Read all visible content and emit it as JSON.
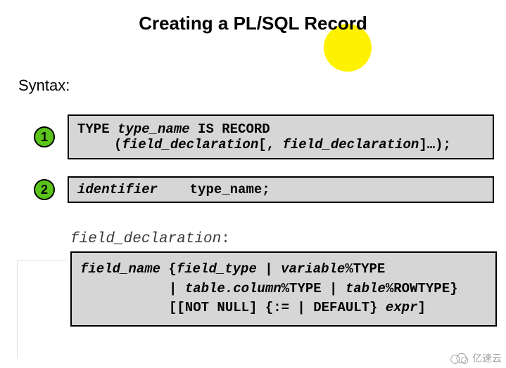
{
  "title": "Creating a PL/SQL Record",
  "syntax_label": "Syntax:",
  "badges": {
    "one": "1",
    "two": "2"
  },
  "code1": {
    "line1_a": "TYPE ",
    "line1_b": "type_name",
    "line1_c": " IS RECORD",
    "line2_a": "(",
    "line2_b": "field_declaration",
    "line2_c": "[, ",
    "line2_d": "field_declaration",
    "line2_e": "]…);"
  },
  "code2": {
    "a": "identifier",
    "spacer": "    ",
    "b": "type_name",
    "c": ";"
  },
  "label_field_decl": "field_declaration",
  "label_colon": ":",
  "code3": {
    "l1_a": "field_name",
    "l1_b": " {",
    "l1_c": "field_type",
    "l1_d": " | ",
    "l1_e": "variable",
    "l1_f": "%TYPE",
    "l2_a": "| ",
    "l2_b": "table.column",
    "l2_c": "%TYPE | ",
    "l2_d": "table",
    "l2_e": "%ROWTYPE}",
    "l3_a": "[[NOT NULL] {:= | DEFAULT} ",
    "l3_b": "expr",
    "l3_c": "]"
  },
  "watermark_text": "亿速云"
}
